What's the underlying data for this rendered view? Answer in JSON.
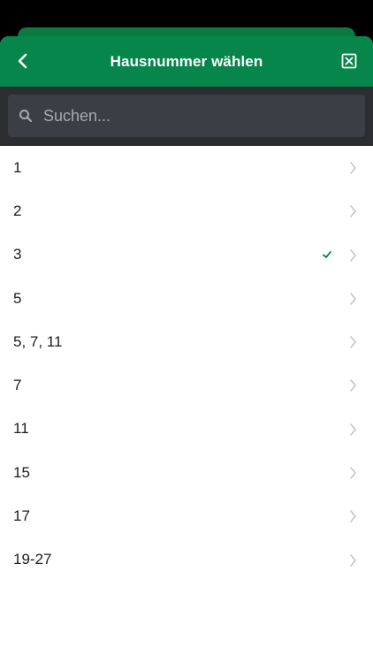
{
  "header": {
    "title": "Hausnummer wählen",
    "back_icon": "chevron-left-icon",
    "close_icon": "close-box-icon"
  },
  "search": {
    "placeholder": "Suchen...",
    "value": "",
    "icon": "search-icon"
  },
  "list": {
    "items": [
      {
        "label": "1",
        "selected": false
      },
      {
        "label": "2",
        "selected": false
      },
      {
        "label": "3",
        "selected": true
      },
      {
        "label": "5",
        "selected": false
      },
      {
        "label": "5, 7, 11",
        "selected": false
      },
      {
        "label": "7",
        "selected": false
      },
      {
        "label": "11",
        "selected": false
      },
      {
        "label": "15",
        "selected": false
      },
      {
        "label": "17",
        "selected": false
      },
      {
        "label": "19-27",
        "selected": false
      }
    ]
  },
  "colors": {
    "accent": "#06864a",
    "search_bar_bg": "#2b2d31",
    "search_field_bg": "#3b3e44"
  }
}
